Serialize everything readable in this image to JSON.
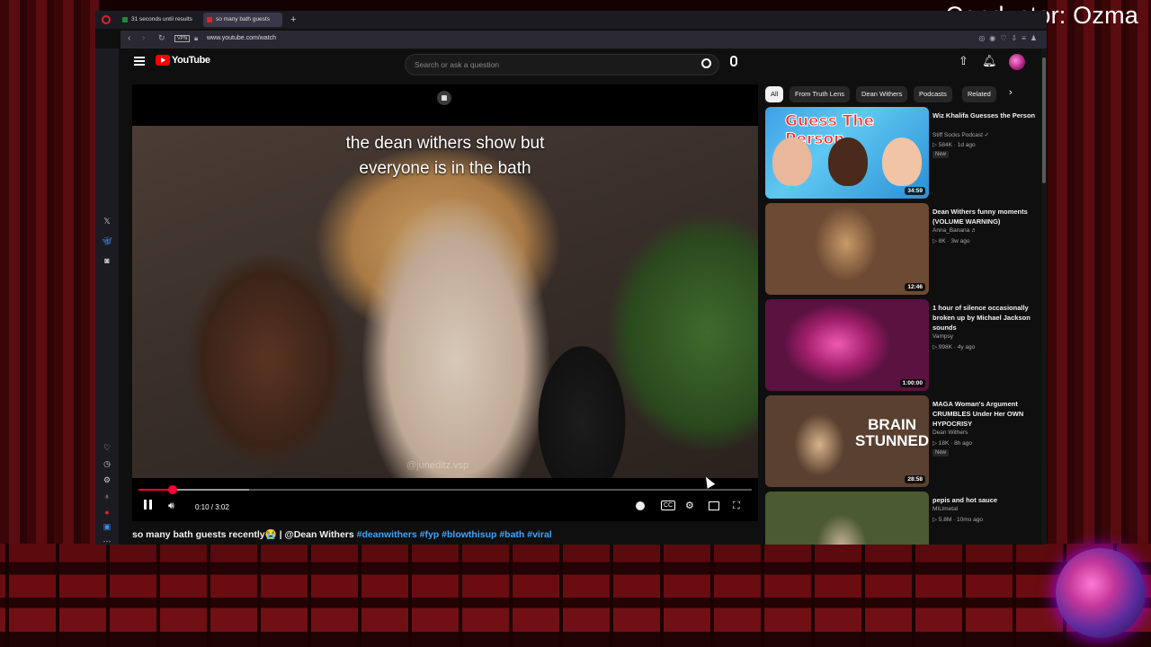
{
  "overlay": {
    "conductor_label": "Conductor: Ozma"
  },
  "browser": {
    "tabs": [
      {
        "label": "31 seconds until results",
        "active": false
      },
      {
        "label": "so many bath guests",
        "active": true
      }
    ],
    "url": "www.youtube.com/watch",
    "vpn_label": "VPN"
  },
  "youtube": {
    "logo_text": "YouTube",
    "search_placeholder": "Search or ask a question",
    "video": {
      "caption_line1": "the dean withers show but",
      "caption_line2": "everyone is in the bath",
      "watermark": "@juneditz.vsp",
      "time_display": "0:10 / 3:02",
      "progress_fraction": 0.055,
      "buffer_fraction": 0.18,
      "title": "so many bath guests recently😭 | @Dean Withers ",
      "hashtags": "#deanwithers #fyp #blowthisup #bath #viral"
    },
    "chips": [
      "All",
      "From Truth Lens",
      "Dean Withers",
      "Podcasts",
      "Related"
    ],
    "recommendations": [
      {
        "title": "Wiz Khalifa Guesses the Person",
        "channel": "Stiff Socks Podcast ✓",
        "meta": "▷ 584K · 1d ago",
        "badge": "New",
        "duration": "34:59",
        "thumb_text": "Guess The Person"
      },
      {
        "title": "Dean Withers funny moments (VOLUME WARNING)",
        "channel": "Anna_Banana ♬",
        "meta": "▷ 8K · 3w ago",
        "badge": "",
        "duration": "12:46",
        "thumb_text": ""
      },
      {
        "title": "1 hour of silence occasionally broken up by Michael Jackson sounds",
        "channel": "Vampsy",
        "meta": "▷ 998K · 4y ago",
        "badge": "",
        "duration": "1:00:00",
        "thumb_text": ""
      },
      {
        "title": "MAGA Woman's Argument CRUMBLES Under Her OWN HYPOCRISY",
        "channel": "Dean Withers",
        "meta": "▷ 18K · 8h ago",
        "badge": "New",
        "duration": "28:58",
        "thumb_text": "BRAIN STUNNED"
      },
      {
        "title": "pepis and hot sauce",
        "channel": "MILlmetal",
        "meta": "▷ 5.8M · 10mo ago",
        "badge": "",
        "duration": "",
        "thumb_text": ""
      }
    ]
  },
  "colors": {
    "accent_red": "#ff0033",
    "link_blue": "#3ea6ff",
    "background": "#0f0f0f"
  }
}
